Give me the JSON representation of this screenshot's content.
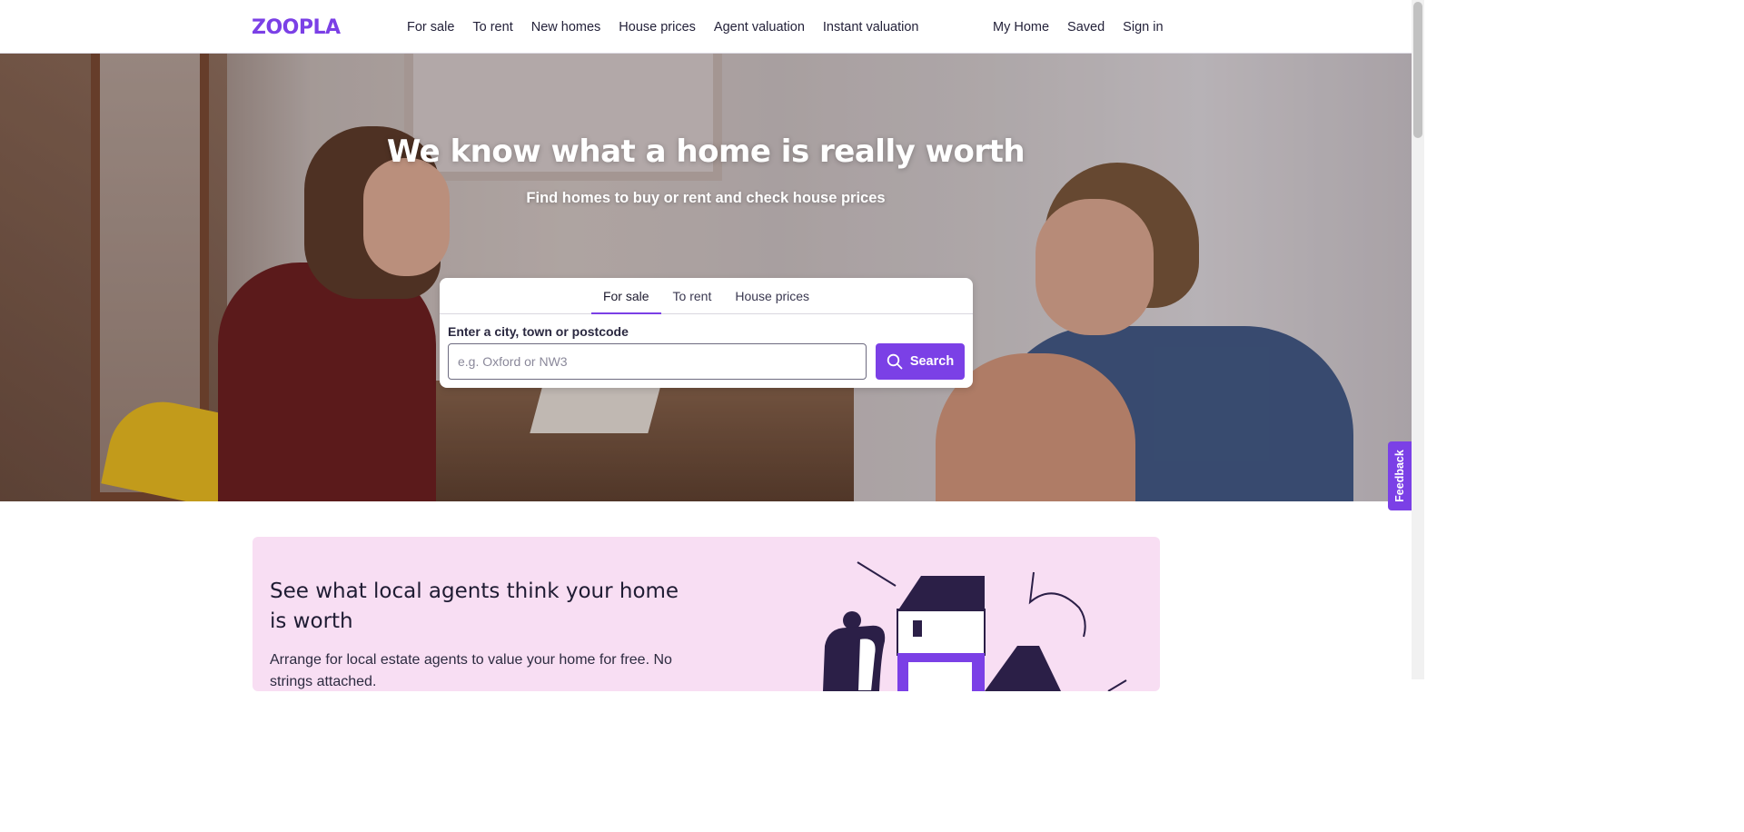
{
  "header": {
    "logo": "ZOOPLA",
    "nav_left": [
      "For sale",
      "To rent",
      "New homes",
      "House prices",
      "Agent valuation",
      "Instant valuation"
    ],
    "nav_right": [
      "My Home",
      "Saved",
      "Sign in"
    ]
  },
  "hero": {
    "title": "We know what a home is really worth",
    "subtitle": "Find homes to buy or rent and check house prices"
  },
  "search": {
    "tabs": [
      "For sale",
      "To rent",
      "House prices"
    ],
    "active_tab": "For sale",
    "label": "Enter a city, town or postcode",
    "value": "",
    "placeholder": "e.g. Oxford or NW3",
    "button_label": "Search",
    "button_icon": "search-icon"
  },
  "feedback": {
    "label": "Feedback"
  },
  "promo": {
    "title": "See what local agents think your home is worth",
    "text": "Arrange for local estate agents to value your home for free. No strings attached."
  },
  "colors": {
    "brand": "#7b40e6",
    "promo_bg": "#f8def3",
    "text_dark": "#1c1a2e"
  }
}
